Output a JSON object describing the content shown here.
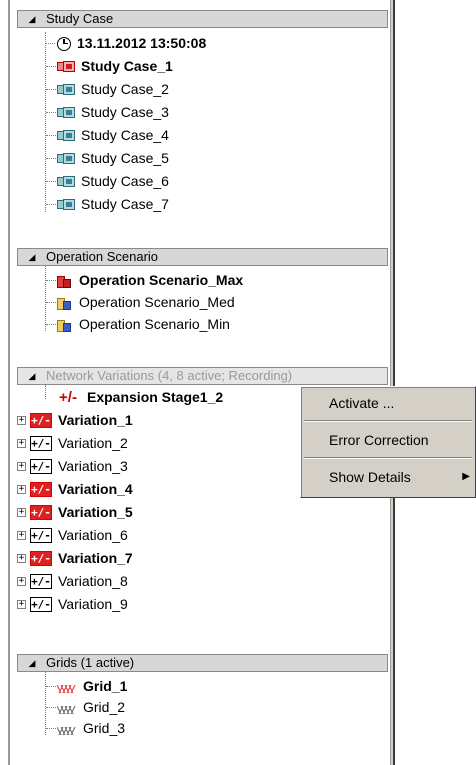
{
  "study_case": {
    "header": "Study Case",
    "timestamp": "13.11.2012 13:50:08",
    "items": [
      {
        "label": "Study Case_1",
        "active": true
      },
      {
        "label": "Study Case_2",
        "active": false
      },
      {
        "label": "Study Case_3",
        "active": false
      },
      {
        "label": "Study Case_4",
        "active": false
      },
      {
        "label": "Study Case_5",
        "active": false
      },
      {
        "label": "Study Case_6",
        "active": false
      },
      {
        "label": "Study Case_7",
        "active": false
      }
    ]
  },
  "operation_scenario": {
    "header": "Operation Scenario",
    "items": [
      {
        "label": "Operation Scenario_Max",
        "active": true
      },
      {
        "label": "Operation Scenario_Med",
        "active": false
      },
      {
        "label": "Operation Scenario_Min",
        "active": false
      }
    ]
  },
  "network_variations": {
    "header": "Network Variations (4, 8 active; Recording)",
    "expansion_stage": {
      "label": "Expansion Stage1_2",
      "icon": "+/-"
    },
    "items": [
      {
        "label": "Variation_1",
        "active": true
      },
      {
        "label": "Variation_2",
        "active": false
      },
      {
        "label": "Variation_3",
        "active": false
      },
      {
        "label": "Variation_4",
        "active": true
      },
      {
        "label": "Variation_5",
        "active": true
      },
      {
        "label": "Variation_6",
        "active": false
      },
      {
        "label": "Variation_7",
        "active": true
      },
      {
        "label": "Variation_8",
        "active": false
      },
      {
        "label": "Variation_9",
        "active": false
      }
    ],
    "icon_text": "+/-",
    "expander_symbol": "+"
  },
  "grids": {
    "header": "Grids (1 active)",
    "items": [
      {
        "label": "Grid_1",
        "active": true
      },
      {
        "label": "Grid_2",
        "active": false
      },
      {
        "label": "Grid_3",
        "active": false
      }
    ]
  },
  "context_menu": {
    "activate": "Activate ...",
    "error_correction": "Error Correction",
    "show_details": "Show Details",
    "submenu_arrow": "▶"
  },
  "header_triangle": "◢",
  "colors": {
    "active_red": "#d00000",
    "header_bg": "#d7d7d7",
    "menu_bg": "#d4d0c8"
  }
}
